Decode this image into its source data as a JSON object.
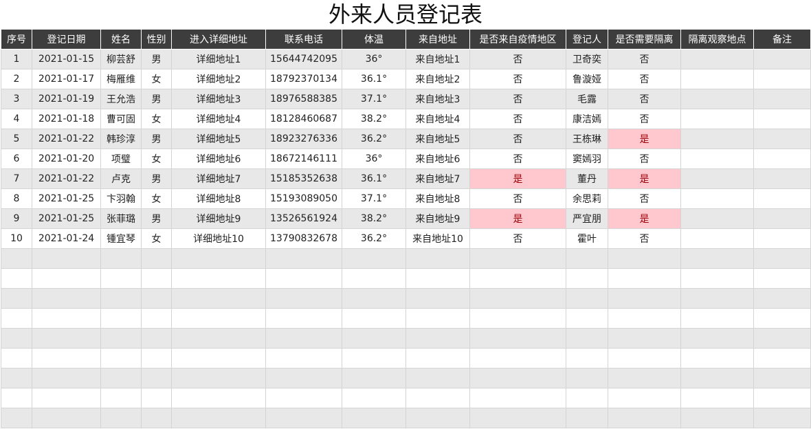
{
  "title": "外来人员登记表",
  "headers": [
    "序号",
    "登记日期",
    "姓名",
    "性别",
    "进入详细地址",
    "联系电话",
    "体温",
    "来自地址",
    "是否来自疫情地区",
    "登记人",
    "是否需要隔离",
    "隔离观察地点",
    "备注"
  ],
  "rows": [
    [
      "1",
      "2021-01-15",
      "柳芸舒",
      "男",
      "详细地址1",
      "15644742095",
      "36°",
      "来自地址1",
      "否",
      "卫奇奕",
      "否",
      "",
      ""
    ],
    [
      "2",
      "2021-01-17",
      "梅雁维",
      "女",
      "详细地址2",
      "18792370134",
      "36.1°",
      "来自地址2",
      "否",
      "鲁漩娅",
      "否",
      "",
      ""
    ],
    [
      "3",
      "2021-01-19",
      "王允浩",
      "男",
      "详细地址3",
      "18976588385",
      "37.1°",
      "来自地址3",
      "否",
      "毛露",
      "否",
      "",
      ""
    ],
    [
      "4",
      "2021-01-18",
      "曹可固",
      "女",
      "详细地址4",
      "18128460687",
      "38.2°",
      "来自地址4",
      "否",
      "康洁嫣",
      "否",
      "",
      ""
    ],
    [
      "5",
      "2021-01-22",
      "韩珍淳",
      "男",
      "详细地址5",
      "18923276336",
      "36.2°",
      "来自地址5",
      "否",
      "王栋琳",
      "是",
      "",
      ""
    ],
    [
      "6",
      "2021-01-20",
      "项璧",
      "女",
      "详细地址6",
      "18672146111",
      "36°",
      "来自地址6",
      "否",
      "窦嫣羽",
      "否",
      "",
      ""
    ],
    [
      "7",
      "2021-01-22",
      "卢克",
      "男",
      "详细地址7",
      "15185352638",
      "36.1°",
      "来自地址7",
      "是",
      "董丹",
      "是",
      "",
      ""
    ],
    [
      "8",
      "2021-01-25",
      "卞羽翰",
      "女",
      "详细地址8",
      "15193089050",
      "37.1°",
      "来自地址8",
      "否",
      "余思莉",
      "否",
      "",
      ""
    ],
    [
      "9",
      "2021-01-25",
      "张菲璐",
      "男",
      "详细地址9",
      "13526561924",
      "38.2°",
      "来自地址9",
      "是",
      "严宜朋",
      "是",
      "",
      ""
    ],
    [
      "10",
      "2021-01-24",
      "锺宜琴",
      "女",
      "详细地址10",
      "13790832678",
      "36.2°",
      "来自地址10",
      "否",
      "霍叶",
      "否",
      "",
      ""
    ]
  ],
  "highlight_value": "是",
  "highlight_color": "#ffc7ce",
  "header_color": "#3d3d3d",
  "stripe_color": "#e8e8e8"
}
